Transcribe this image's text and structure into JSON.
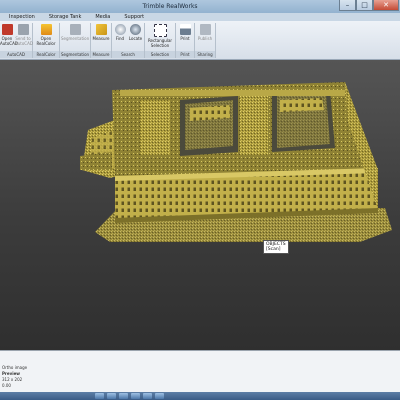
{
  "window": {
    "title": "Trimble RealWorks",
    "controls": {
      "minimize": "–",
      "maximize": "□",
      "close": "✕"
    }
  },
  "menubar": {
    "items": [
      "Inspection",
      "Storage Tank",
      "Media",
      "Support"
    ]
  },
  "ribbon": {
    "buttons": {
      "autocad": "Open AutoCAD",
      "sendto": "Send to AutoCAD",
      "realcolor": "Open RealColor",
      "segmentation": "Segmentation",
      "measure": "Measure",
      "find": "Find",
      "locate": "Locate",
      "rect_line1": "Rectangular",
      "rect_line2": "Selection",
      "print": "Print",
      "publish": "Publish"
    },
    "groups": {
      "autocad": "AutoCAD",
      "realcolor": "RealColor",
      "segmentation": "Segmentation",
      "measure": "Measure",
      "search": "Search",
      "selection": "Selection",
      "print": "Print",
      "sharing": "Sharing"
    }
  },
  "viewport": {
    "tooltip_line1": "OBJECTS",
    "tooltip_line2": "[Scan]"
  },
  "bottom_panel": {
    "row1": "Ortho image",
    "row2": "Preview",
    "row3": "312 x 202",
    "row4": "0.00"
  },
  "colors": {
    "titlebar": "#a8c3dc",
    "point_cloud": "#b7a640",
    "viewport_bg": "#454545"
  },
  "icons": {
    "taskbar": [
      "ie-icon",
      "folder-icon",
      "media-icon",
      "app-icon",
      "app-icon",
      "app-icon"
    ]
  }
}
